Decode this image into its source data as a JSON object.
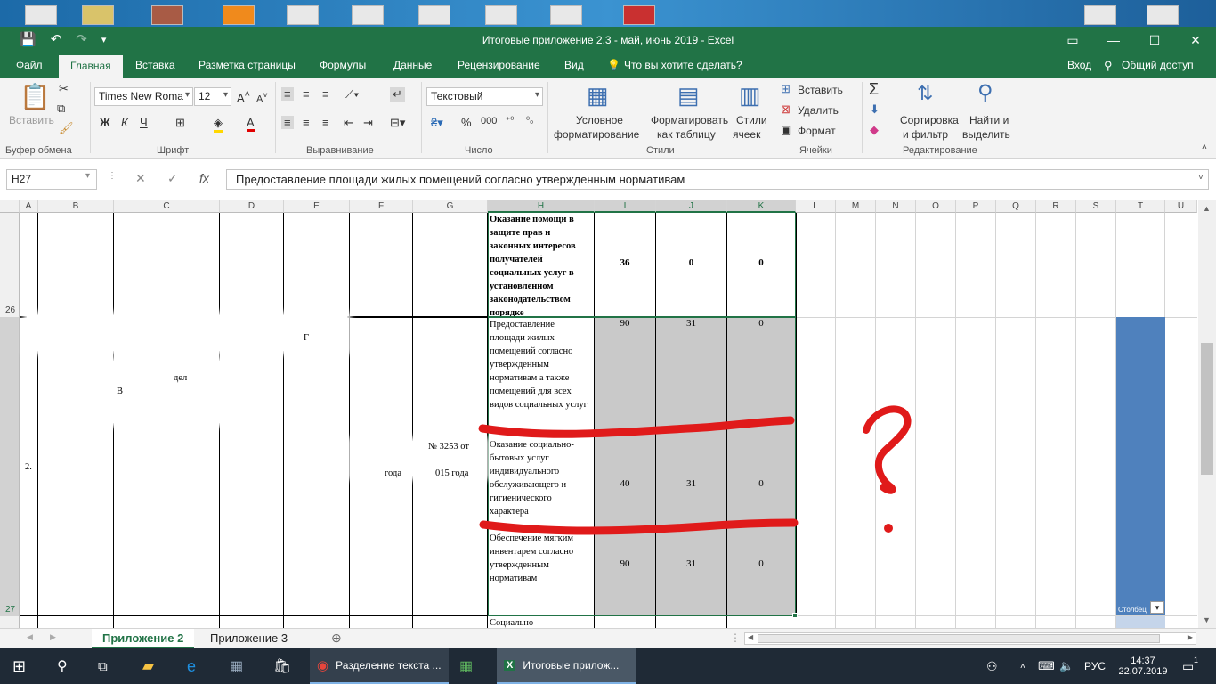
{
  "window": {
    "title": "Итоговые приложение 2,3 - май, июнь 2019 - Excel"
  },
  "menu": {
    "file": "Файл",
    "home": "Главная",
    "insert": "Вставка",
    "layout": "Разметка страницы",
    "formulas": "Формулы",
    "data": "Данные",
    "review": "Рецензирование",
    "view": "Вид",
    "tell_me": "Что вы хотите сделать?",
    "signin": "Вход",
    "share": "Общий доступ"
  },
  "ribbon": {
    "paste": "Вставить",
    "clipboard": "Буфер обмена",
    "font_name": "Times New Roma",
    "font_size": "12",
    "font_group": "Шрифт",
    "align_group": "Выравнивание",
    "number_format": "Текстовый",
    "number_group": "Число",
    "cond_format_1": "Условное",
    "cond_format_2": "форматирование",
    "format_table_1": "Форматировать",
    "format_table_2": "как таблицу",
    "cell_styles_1": "Стили",
    "cell_styles_2": "ячеек",
    "styles_group": "Стили",
    "insert": "Вставить",
    "delete": "Удалить",
    "format": "Формат",
    "cells_group": "Ячейки",
    "sort_1": "Сортировка",
    "sort_2": "и фильтр",
    "find_1": "Найти и",
    "find_2": "выделить",
    "editing_group": "Редактирование",
    "bold": "Ж",
    "italic": "К",
    "underline": "Ч"
  },
  "formula": {
    "namebox": "H27",
    "content": "Предоставление площади жилых помещений согласно утвержденным нормативам"
  },
  "columns": [
    "A",
    "B",
    "C",
    "D",
    "E",
    "F",
    "G",
    "H",
    "I",
    "J",
    "K",
    "L",
    "M",
    "N",
    "O",
    "P",
    "Q",
    "R",
    "S",
    "T",
    "U"
  ],
  "rows": {
    "r26": "26",
    "r27": "27"
  },
  "cells": {
    "h26": "Оказание помощи в защите прав и законных интересов получателей социальных услуг в установленном законодательством порядке",
    "i26": "36",
    "j26": "0",
    "k26": "0",
    "a27": "2.",
    "h27a": "Предоставление площади жилых помещений согласно утвержденным нормативам а также помещений для всех видов социальных услуг",
    "i27a": "90",
    "j27a": "31",
    "k27a": "0",
    "h27b": "Оказание социально-бытовых услуг индивидуального обслуживающего и гигиенического характера",
    "i27b": "40",
    "j27b": "31",
    "k27b": "0",
    "h27c": "Обеспечение мягким инвентарем согласно утвержденным нормативам",
    "i27c": "90",
    "j27c": "31",
    "k27c": "0",
    "h28": "Социально-",
    "frag_del": "дел",
    "frag_b": "В",
    "frag_g": "Г",
    "frag_num": "№ 3253 от",
    "frag_year": "года",
    "frag_year2": "015 года",
    "t_filter": "Столбец"
  },
  "sheets": {
    "tab1": "Приложение 2",
    "tab2": "Приложение 3"
  },
  "taskbar": {
    "chrome": "Разделение текста ...",
    "excel": "Итоговые прилож...",
    "lang": "РУС",
    "time": "14:37",
    "date": "22.07.2019",
    "notif": "1"
  },
  "colors": {
    "excel_green": "#217346",
    "annotation_red": "#e01a1a",
    "chart_blue": "#4f81bd"
  }
}
